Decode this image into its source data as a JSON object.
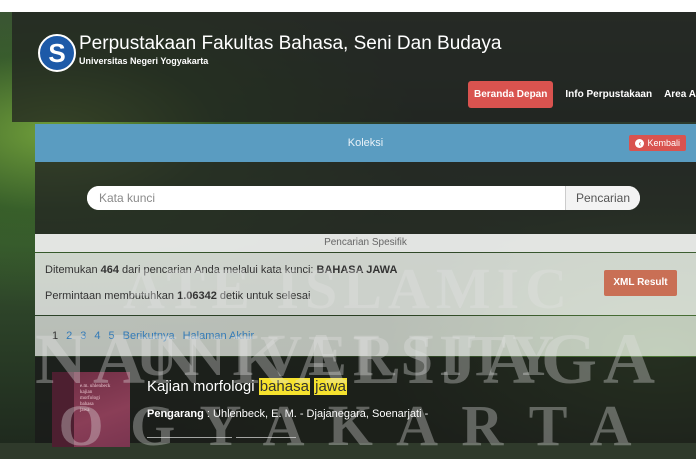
{
  "header": {
    "title": "Perpustakaan Fakultas Bahasa, Seni Dan Budaya",
    "subtitle": "Universitas Negeri Yogyakarta",
    "logo_letter": "S",
    "nav": [
      {
        "label": "Beranda Depan",
        "active": true
      },
      {
        "label": "Info Perpustakaan",
        "active": false
      },
      {
        "label": "Area A",
        "active": false
      }
    ]
  },
  "koleksi": {
    "title": "Koleksi",
    "back_label": "Kembali"
  },
  "search": {
    "placeholder": "Kata kunci",
    "button_label": "Pencarian"
  },
  "specific_search_label": "Pencarian Spesifik",
  "results": {
    "found_prefix": "Ditemukan ",
    "count": "464",
    "found_middle": " dari pencarian Anda melalui kata kunci: ",
    "keyword": "BAHASA JAWA",
    "time_prefix": "Permintaan membutuhkan ",
    "time": "1.06342",
    "time_suffix": " detik untuk selesai",
    "xml_button": "XML Result"
  },
  "pagination": [
    "1",
    "2",
    "3",
    "4",
    "5",
    "Berikutnya",
    "Halaman Akhir"
  ],
  "item": {
    "title_prefix": "Kajian morfologi ",
    "title_hl1": "bahasa",
    "title_hl2": "jawa",
    "author_label": "Pengarang",
    "author_value": " : Uhlenbeck, E. M. - Djajanegara, Soenarjati -",
    "cover_lines": [
      "e.m. uhlenbeck",
      "kajian",
      "morfologi",
      "bahasa",
      "jawa"
    ]
  },
  "watermark": [
    "ATE ISLAMIC UNIVERSITY",
    "NAN KALIJAGA",
    "O G Y A K A R T A"
  ],
  "colors": {
    "accent_red": "#d9534f",
    "koleksi_blue": "#5a9cc1",
    "xml_orange": "#c96f55",
    "highlight": "#f6e22e",
    "link": "#337ab7"
  }
}
